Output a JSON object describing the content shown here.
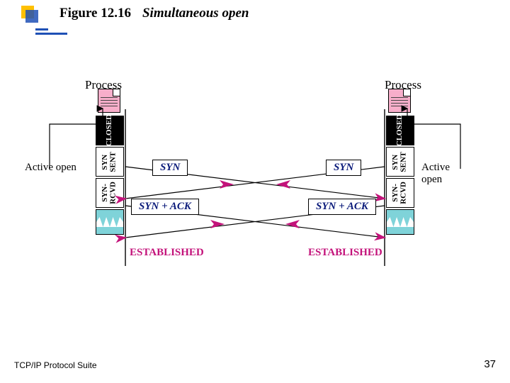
{
  "header": {
    "figure_number": "Figure 12.16",
    "title": "Simultaneous open"
  },
  "footer": {
    "left": "TCP/IP Protocol Suite",
    "page": "37"
  },
  "diagram": {
    "left": {
      "process_label": "Process",
      "active_open": "Active open",
      "states": {
        "closed": "CLOSED",
        "syn_sent": "SYN\nSENT",
        "syn_rcvd": "SYN-\nRCVD"
      },
      "established": "ESTABLISHED"
    },
    "right": {
      "process_label": "Process",
      "active_open": "Active open",
      "states": {
        "closed": "CLOSED",
        "syn_sent": "SYN\nSENT",
        "syn_rcvd": "SYN-\nRCVD"
      },
      "established": "ESTABLISHED"
    },
    "messages": {
      "syn_left": "SYN",
      "syn_right": "SYN",
      "synack_left": "SYN + ACK",
      "synack_right": "SYN + ACK"
    }
  },
  "chart_data": {
    "type": "sequence-state-diagram",
    "title": "Simultaneous open",
    "peers": [
      "Left Process",
      "Right Process"
    ],
    "states_per_peer": [
      "CLOSED",
      "SYN SENT",
      "SYN-RCVD",
      "ESTABLISHED"
    ],
    "events": [
      {
        "at": "Left",
        "trigger": "Active open",
        "from": "CLOSED",
        "to": "SYN SENT"
      },
      {
        "at": "Right",
        "trigger": "Active open",
        "from": "CLOSED",
        "to": "SYN SENT"
      },
      {
        "msg": "SYN",
        "from": "Left",
        "to": "Right",
        "causes": {
          "peer": "Right",
          "to": "SYN-RCVD"
        }
      },
      {
        "msg": "SYN",
        "from": "Right",
        "to": "Left",
        "causes": {
          "peer": "Left",
          "to": "SYN-RCVD"
        }
      },
      {
        "msg": "SYN + ACK",
        "from": "Left",
        "to": "Right",
        "causes": {
          "peer": "Right",
          "to": "ESTABLISHED"
        }
      },
      {
        "msg": "SYN + ACK",
        "from": "Right",
        "to": "Left",
        "causes": {
          "peer": "Left",
          "to": "ESTABLISHED"
        }
      }
    ]
  }
}
